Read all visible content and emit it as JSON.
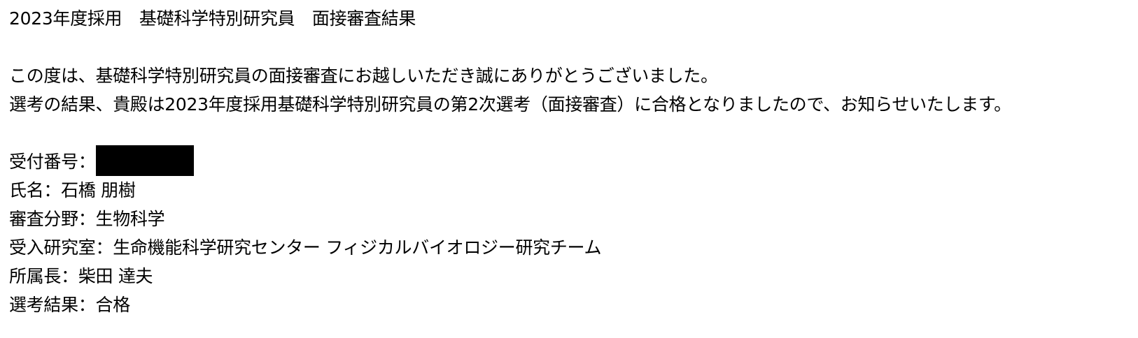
{
  "document": {
    "title": "2023年度採用　基礎科学特別研究員　面接審査結果",
    "paragraph_lines": [
      "この度は、基礎科学特別研究員の面接審査にお越しいただき誠にありがとうございました。",
      "選考の結果、貴殿は2023年度採用基礎科学特別研究員の第2次選考（面接審査）に合格となりましたので、お知らせいたします。"
    ],
    "fields": {
      "receipt_number": {
        "label": "受付番号："
      },
      "name": {
        "label": "氏名：",
        "value": "石橋 朋樹"
      },
      "field": {
        "label": "審査分野：",
        "value": "生物科学"
      },
      "lab": {
        "label": "受入研究室：",
        "value": "生命機能科学研究センター フィジカルバイオロジー研究チーム"
      },
      "supervisor": {
        "label": "所属長：",
        "value": "柴田 達夫"
      },
      "result": {
        "label": "選考結果：",
        "value": "合格"
      }
    }
  }
}
